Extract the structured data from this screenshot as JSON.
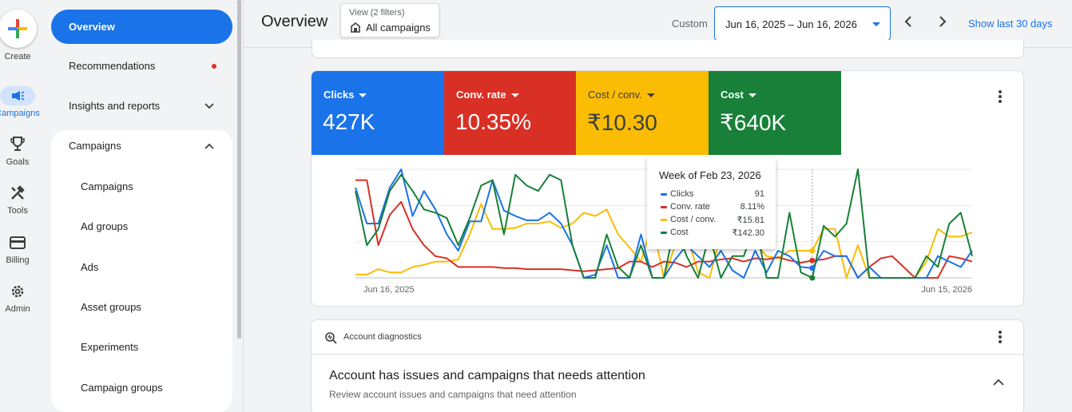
{
  "rail": {
    "create": "Create",
    "items": [
      {
        "label": "Campaigns",
        "icon": "megaphone-icon"
      },
      {
        "label": "Goals",
        "icon": "trophy-icon"
      },
      {
        "label": "Tools",
        "icon": "tools-icon"
      },
      {
        "label": "Billing",
        "icon": "credit-card-icon"
      },
      {
        "label": "Admin",
        "icon": "gear-icon"
      }
    ]
  },
  "sidenav": {
    "overview": "Overview",
    "recommendations": "Recommendations",
    "insights": "Insights and reports",
    "campaigns_section": "Campaigns",
    "sub_items": [
      "Campaigns",
      "Ad groups",
      "Ads",
      "Asset groups",
      "Experiments",
      "Campaign groups"
    ]
  },
  "header": {
    "title": "Overview",
    "view_label": "View (2 filters)",
    "view_value": "All campaigns",
    "custom": "Custom",
    "date_range": "Jun 16, 2025 – Jun 16, 2026",
    "show_last": "Show last 30 days"
  },
  "metrics": [
    {
      "name": "Clicks",
      "value": "427K",
      "color": "#1a73e8"
    },
    {
      "name": "Conv. rate",
      "value": "10.35%",
      "color": "#d93025"
    },
    {
      "name": "Cost / conv.",
      "value": "₹10.30",
      "color": "#fbbc04"
    },
    {
      "name": "Cost",
      "value": "₹640K",
      "color": "#188038"
    }
  ],
  "tooltip": {
    "title": "Week of Feb 23, 2026",
    "rows": [
      {
        "label": "Clicks",
        "value": "91",
        "color": "#1a73e8"
      },
      {
        "label": "Conv. rate",
        "value": "8.11%",
        "color": "#d93025"
      },
      {
        "label": "Cost / conv.",
        "value": "₹15.81",
        "color": "#fbbc04"
      },
      {
        "label": "Cost",
        "value": "₹142.30",
        "color": "#188038"
      }
    ]
  },
  "chart_data": {
    "type": "line",
    "x_start_label": "Jun 16, 2025",
    "x_end_label": "Jun 15, 2026",
    "highlight_index": 40,
    "series": [
      {
        "name": "Clicks",
        "color": "#1a73e8",
        "values": [
          83,
          50,
          50,
          83,
          100,
          57,
          80,
          63,
          40,
          25,
          52,
          52,
          90,
          62,
          57,
          53,
          53,
          60,
          50,
          30,
          0,
          3,
          30,
          0,
          0,
          40,
          0,
          0,
          17,
          30,
          20,
          10,
          25,
          7,
          0,
          25,
          5,
          25,
          20,
          10,
          9,
          25,
          20,
          20,
          0,
          10,
          0,
          0,
          0,
          0,
          0,
          20,
          15,
          10,
          25
        ]
      },
      {
        "name": "Conv. rate",
        "color": "#d93025",
        "values": [
          90,
          90,
          30,
          58,
          70,
          45,
          30,
          20,
          18,
          10,
          10,
          10,
          10,
          9,
          9,
          8,
          8,
          8,
          8,
          7,
          6,
          7,
          8,
          9,
          15,
          15,
          10,
          15,
          14,
          10,
          15,
          15,
          17,
          18,
          15,
          18,
          17,
          19,
          16,
          14,
          16,
          17,
          20,
          20,
          0,
          10,
          18,
          20,
          10,
          0,
          0,
          0,
          20,
          18,
          15
        ]
      },
      {
        "name": "Cost / conv.",
        "color": "#fbbc04",
        "values": [
          3,
          3,
          8,
          5,
          5,
          10,
          12,
          15,
          15,
          17,
          40,
          68,
          45,
          45,
          46,
          50,
          50,
          52,
          46,
          50,
          60,
          57,
          63,
          40,
          28,
          15,
          50,
          0,
          30,
          40,
          5,
          0,
          40,
          42,
          40,
          32,
          20,
          18,
          25,
          25,
          25,
          45,
          45,
          0,
          30,
          0,
          0,
          0,
          0,
          0,
          15,
          45,
          38,
          38,
          42
        ]
      },
      {
        "name": "Cost",
        "color": "#188038",
        "values": [
          80,
          30,
          45,
          80,
          95,
          80,
          63,
          60,
          55,
          30,
          55,
          85,
          90,
          40,
          95,
          85,
          80,
          95,
          90,
          30,
          0,
          0,
          40,
          10,
          0,
          30,
          0,
          0,
          50,
          20,
          0,
          40,
          0,
          20,
          20,
          50,
          0,
          0,
          60,
          5,
          0,
          48,
          38,
          50,
          100,
          0,
          0,
          0,
          0,
          0,
          20,
          10,
          50,
          60,
          20
        ]
      }
    ]
  },
  "diagnostics": {
    "header": "Account diagnostics",
    "title": "Account has issues and campaigns that needs attention",
    "subtitle": "Review account issues and campaigns that need attention"
  }
}
